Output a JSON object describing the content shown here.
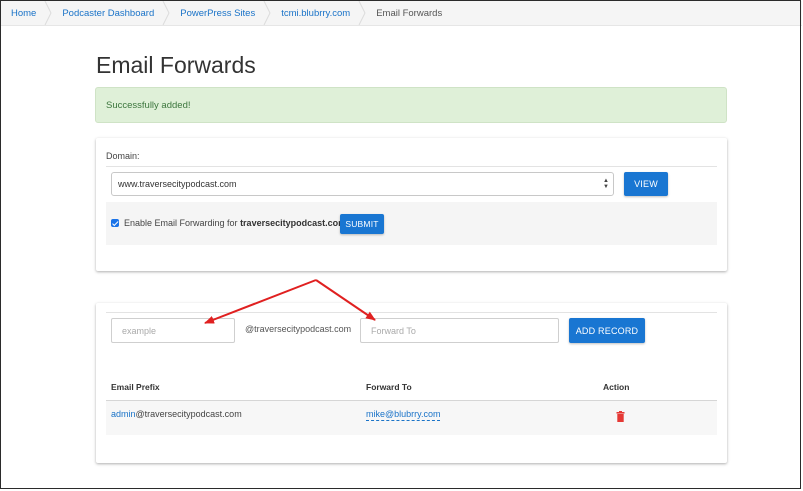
{
  "breadcrumb": [
    "Home",
    "Podcaster Dashboard",
    "PowerPress Sites",
    "tcmi.blubrry.com",
    "Email Forwards"
  ],
  "page_title": "Email Forwards",
  "alert": "Successfully added!",
  "domain_section": {
    "label": "Domain:",
    "selected_domain": "www.traversecitypodcast.com",
    "view_button": "VIEW",
    "checkbox_text": "Enable Email Forwarding for ",
    "checkbox_domain": "traversecitypodcast.com",
    "checkbox_checked": true,
    "submit_button": "SUBMIT"
  },
  "record_form": {
    "prefix_placeholder": "example",
    "at_domain": "@traversecitypodcast.com",
    "forward_placeholder": "Forward To",
    "add_button": "ADD RECORD"
  },
  "table": {
    "headers": [
      "Email Prefix",
      "Forward To",
      "Action"
    ],
    "rows": [
      {
        "prefix_user": "admin",
        "prefix_domain": "@traversecitypodcast.com",
        "forward_to": "mike@blubrry.com",
        "action_icon": "trash-icon"
      }
    ]
  },
  "colors": {
    "link": "#1a73c8",
    "button": "#1976d2",
    "alert_bg": "#dff0d8",
    "alert_text": "#3c763d",
    "annotation_arrow": "#e02020",
    "delete": "#e53935"
  }
}
